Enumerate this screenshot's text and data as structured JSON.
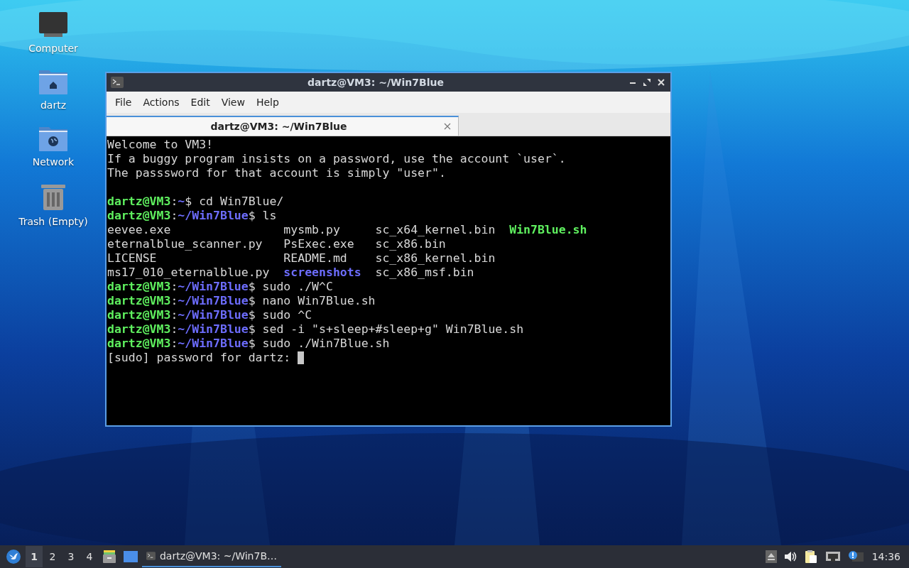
{
  "desktop": {
    "icons": [
      {
        "label": "Computer",
        "kind": "computer"
      },
      {
        "label": "dartz",
        "kind": "home"
      },
      {
        "label": "Network",
        "kind": "network"
      },
      {
        "label": "Trash (Empty)",
        "kind": "trash"
      }
    ]
  },
  "window": {
    "title": "dartz@VM3: ~/Win7Blue",
    "menu": [
      "File",
      "Actions",
      "Edit",
      "View",
      "Help"
    ],
    "tabs": [
      {
        "label": "dartz@VM3: ~/Win7Blue",
        "selected": true
      }
    ],
    "terminal": {
      "lines": [
        {
          "kind": "text",
          "text": "Welcome to VM3!"
        },
        {
          "kind": "text",
          "text": "If a buggy program insists on a password, use the account `user`."
        },
        {
          "kind": "text",
          "text": "The passsword for that account is simply \"user\"."
        },
        {
          "kind": "blank"
        },
        {
          "kind": "prompt",
          "user": "dartz@VM3",
          "sep": ":",
          "path": "~",
          "command": "$ cd Win7Blue/"
        },
        {
          "kind": "prompt",
          "user": "dartz@VM3",
          "sep": ":",
          "path": "~/Win7Blue",
          "command": "$ ls"
        },
        {
          "kind": "listing",
          "cells": [
            {
              "text": "eevee.exe",
              "kind": "file"
            },
            {
              "text": "mysmb.py",
              "kind": "file"
            },
            {
              "text": "sc_x64_kernel.bin",
              "kind": "file"
            },
            {
              "text": "Win7Blue.sh",
              "kind": "exec"
            }
          ]
        },
        {
          "kind": "listing",
          "cells": [
            {
              "text": "eternalblue_scanner.py",
              "kind": "file"
            },
            {
              "text": "PsExec.exe",
              "kind": "file"
            },
            {
              "text": "sc_x86.bin",
              "kind": "file"
            }
          ]
        },
        {
          "kind": "listing",
          "cells": [
            {
              "text": "LICENSE",
              "kind": "file"
            },
            {
              "text": "README.md",
              "kind": "file"
            },
            {
              "text": "sc_x86_kernel.bin",
              "kind": "file"
            }
          ]
        },
        {
          "kind": "listing",
          "cells": [
            {
              "text": "ms17_010_eternalblue.py",
              "kind": "file"
            },
            {
              "text": "screenshots",
              "kind": "dir"
            },
            {
              "text": "sc_x86_msf.bin",
              "kind": "file"
            }
          ]
        },
        {
          "kind": "prompt",
          "user": "dartz@VM3",
          "sep": ":",
          "path": "~/Win7Blue",
          "command": "$ sudo ./W^C"
        },
        {
          "kind": "prompt",
          "user": "dartz@VM3",
          "sep": ":",
          "path": "~/Win7Blue",
          "command": "$ nano Win7Blue.sh"
        },
        {
          "kind": "prompt",
          "user": "dartz@VM3",
          "sep": ":",
          "path": "~/Win7Blue",
          "command": "$ sudo ^C"
        },
        {
          "kind": "prompt",
          "user": "dartz@VM3",
          "sep": ":",
          "path": "~/Win7Blue",
          "command": "$ sed -i \"s+sleep+#sleep+g\" Win7Blue.sh"
        },
        {
          "kind": "prompt",
          "user": "dartz@VM3",
          "sep": ":",
          "path": "~/Win7Blue",
          "command": "$ sudo ./Win7Blue.sh"
        },
        {
          "kind": "text",
          "text": "[sudo] password for dartz:",
          "cursor": true
        }
      ]
    }
  },
  "taskbar": {
    "workspaces": [
      {
        "label": "1",
        "selected": true
      },
      {
        "label": "2",
        "selected": false
      },
      {
        "label": "3",
        "selected": false
      },
      {
        "label": "4",
        "selected": false
      }
    ],
    "tasks": [
      {
        "label": "dartz@VM3: ~/Win7B…",
        "selected": true
      }
    ],
    "clock": "14:36"
  }
}
